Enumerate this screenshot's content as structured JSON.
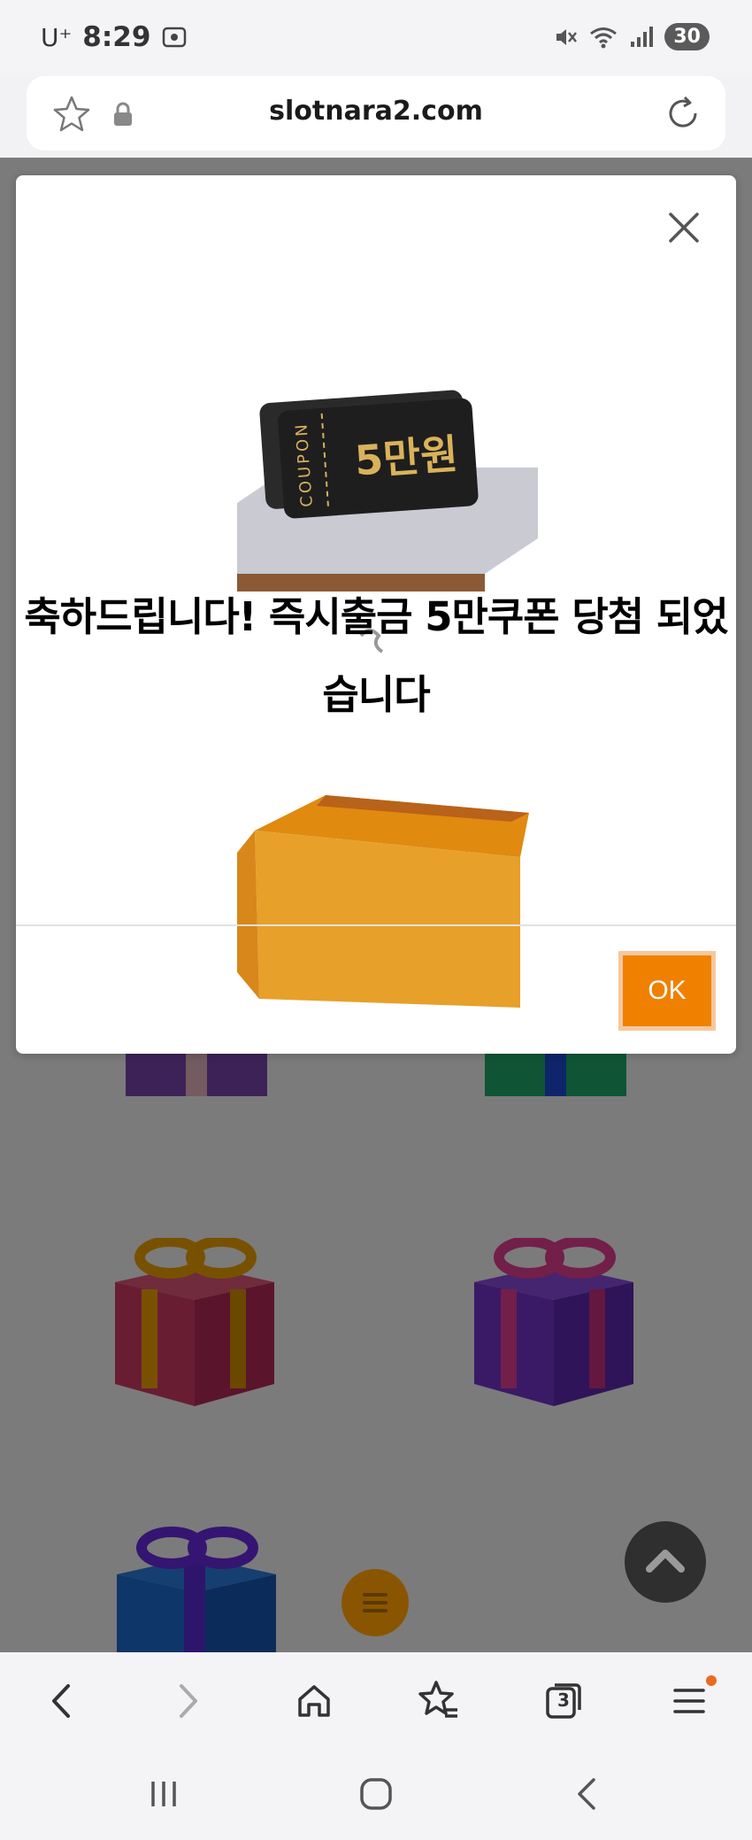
{
  "status_bar": {
    "carrier": "U⁺",
    "time": "8:29",
    "battery": "30",
    "icons": [
      "screenshot-icon",
      "mute-icon",
      "wifi-icon",
      "signal-icon"
    ]
  },
  "address_bar": {
    "url": "slotnara2.com",
    "icons": [
      "bookmark-star-icon",
      "lock-icon",
      "reload-icon"
    ]
  },
  "modal": {
    "coupon_label": "COUPON",
    "coupon_value": "5만원",
    "message_line1": "축하드립니다! 즉시출금 5만쿠폰 당첨 되었",
    "message_line2": "습니다",
    "ok_label": "OK",
    "accent_color": "#f08000"
  },
  "bottom_toolbar": {
    "tab_count": "3",
    "icons": [
      "back-icon",
      "forward-icon",
      "home-icon",
      "bookmarks-icon",
      "tabs-icon",
      "menu-icon"
    ]
  },
  "system_nav": {
    "icons": [
      "recent-apps-icon",
      "home-nav-icon",
      "back-nav-icon"
    ]
  }
}
